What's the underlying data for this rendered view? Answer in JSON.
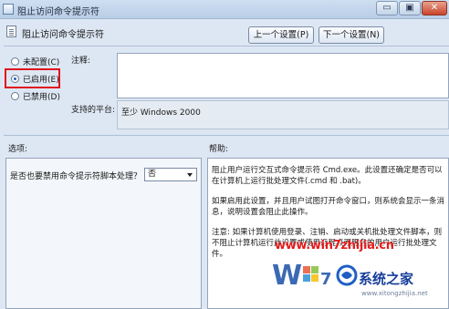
{
  "window": {
    "title": "阻止访问命令提示符",
    "min_label": "▭",
    "max_label": "▣",
    "close_label": "✕"
  },
  "header": {
    "setting_name": "阻止访问命令提示符",
    "prev_button": "上一个设置(P)",
    "next_button": "下一个设置(N)"
  },
  "state": {
    "options": [
      {
        "label": "未配置(C)",
        "selected": false
      },
      {
        "label": "已启用(E)",
        "selected": true
      },
      {
        "label": "已禁用(D)",
        "selected": false
      }
    ]
  },
  "comment": {
    "label": "注释:",
    "value": ""
  },
  "platform": {
    "label": "支持的平台:",
    "value": "至少 Windows 2000"
  },
  "options_section": {
    "label": "选项:",
    "question": "是否也要禁用命令提示符脚本处理？",
    "select_value": "否"
  },
  "help_section": {
    "label": "帮助:",
    "paragraphs": [
      "阻止用户运行交互式命令提示符 Cmd.exe。此设置还确定是否可以在计算机上运行批处理文件(.cmd 和 .bat)。",
      "如果启用此设置，并且用户试图打开命令窗口，则系统会显示一条消息，说明设置会阻止此操作。",
      "注意: 如果计算机使用登录、注销、启动或关机批处理文件脚本，则不阻止计算机运行此设置或使用远程桌面服务的用户运行批处理文件。"
    ]
  },
  "watermark": {
    "url": "www.win7zhijia.cn",
    "logo_text": "Win7",
    "brand": "系统之家",
    "site": "www.xitongzhijia.net"
  }
}
